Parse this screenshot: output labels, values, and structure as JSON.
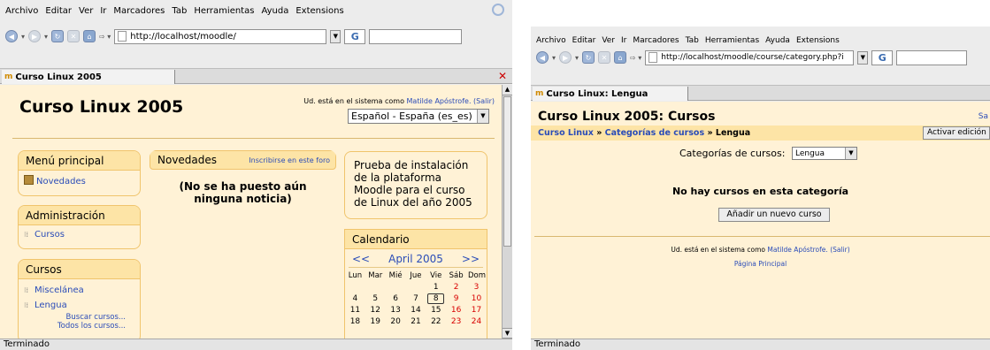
{
  "menu": [
    "Archivo",
    "Editar",
    "Ver",
    "Ir",
    "Marcadores",
    "Tab",
    "Herramientas",
    "Ayuda",
    "Extensions"
  ],
  "left": {
    "url": "http://localhost/moodle/",
    "tab_title": "Curso Linux 2005",
    "site_title": "Curso Linux 2005",
    "logged_prefix": "Ud. está en el sistema como",
    "user": "Matilde Apóstrofe.",
    "logout": "(Salir)",
    "language": "Español - España (es_es)",
    "main_menu": {
      "title": "Menú principal",
      "items": [
        "Novedades"
      ]
    },
    "admin": {
      "title": "Administración",
      "items": [
        "Cursos"
      ]
    },
    "courses": {
      "title": "Cursos",
      "items": [
        "Miscelánea",
        "Lengua"
      ],
      "search": "Buscar cursos...",
      "all": "Todos los cursos..."
    },
    "news": {
      "title": "Novedades",
      "subscribe": "Inscribirse en este foro",
      "empty": "(No se ha puesto aún ninguna noticia)"
    },
    "summary": "Prueba de instalación de la plataforma Moodle para el curso de Linux del año 2005",
    "calendar": {
      "title": "Calendario",
      "prev": "<<",
      "month": "April 2005",
      "next": ">>",
      "days": [
        "Lun",
        "Mar",
        "Mié",
        "Jue",
        "Vie",
        "Sáb",
        "Dom"
      ],
      "weeks": [
        [
          "",
          "",
          "",
          "",
          "1",
          "2",
          "3"
        ],
        [
          "4",
          "5",
          "6",
          "7",
          "8",
          "9",
          "10"
        ],
        [
          "11",
          "12",
          "13",
          "14",
          "15",
          "16",
          "17"
        ],
        [
          "18",
          "19",
          "20",
          "21",
          "22",
          "23",
          "24"
        ]
      ],
      "today": "8"
    },
    "status": "Terminado"
  },
  "right": {
    "url": "http://localhost/moodle/course/category.php?i",
    "tab_title": "Curso Linux: Lengua",
    "page_title": "Curso Linux 2005: Cursos",
    "corner_text": "Sa",
    "breadcrumb": {
      "home": "Curso Linux",
      "sep1": "»",
      "categories": "Categorías de cursos",
      "sep2": "»",
      "current": "Lengua"
    },
    "edit_button": "Activar edición",
    "category_label": "Categorías de cursos:",
    "category_value": "Lengua",
    "empty_message": "No hay cursos en esta categoría",
    "add_button": "Añadir un nuevo curso",
    "logged_prefix": "Ud. está en el sistema como",
    "user": "Matilde Apóstrofe.",
    "logout": "(Salir)",
    "home_link": "Página Principal",
    "status": "Terminado"
  },
  "colors": {
    "page_bg": "#fff2d6",
    "block_header": "#fde4a6",
    "link": "#2a4cb8",
    "weekend": "#d80000"
  }
}
